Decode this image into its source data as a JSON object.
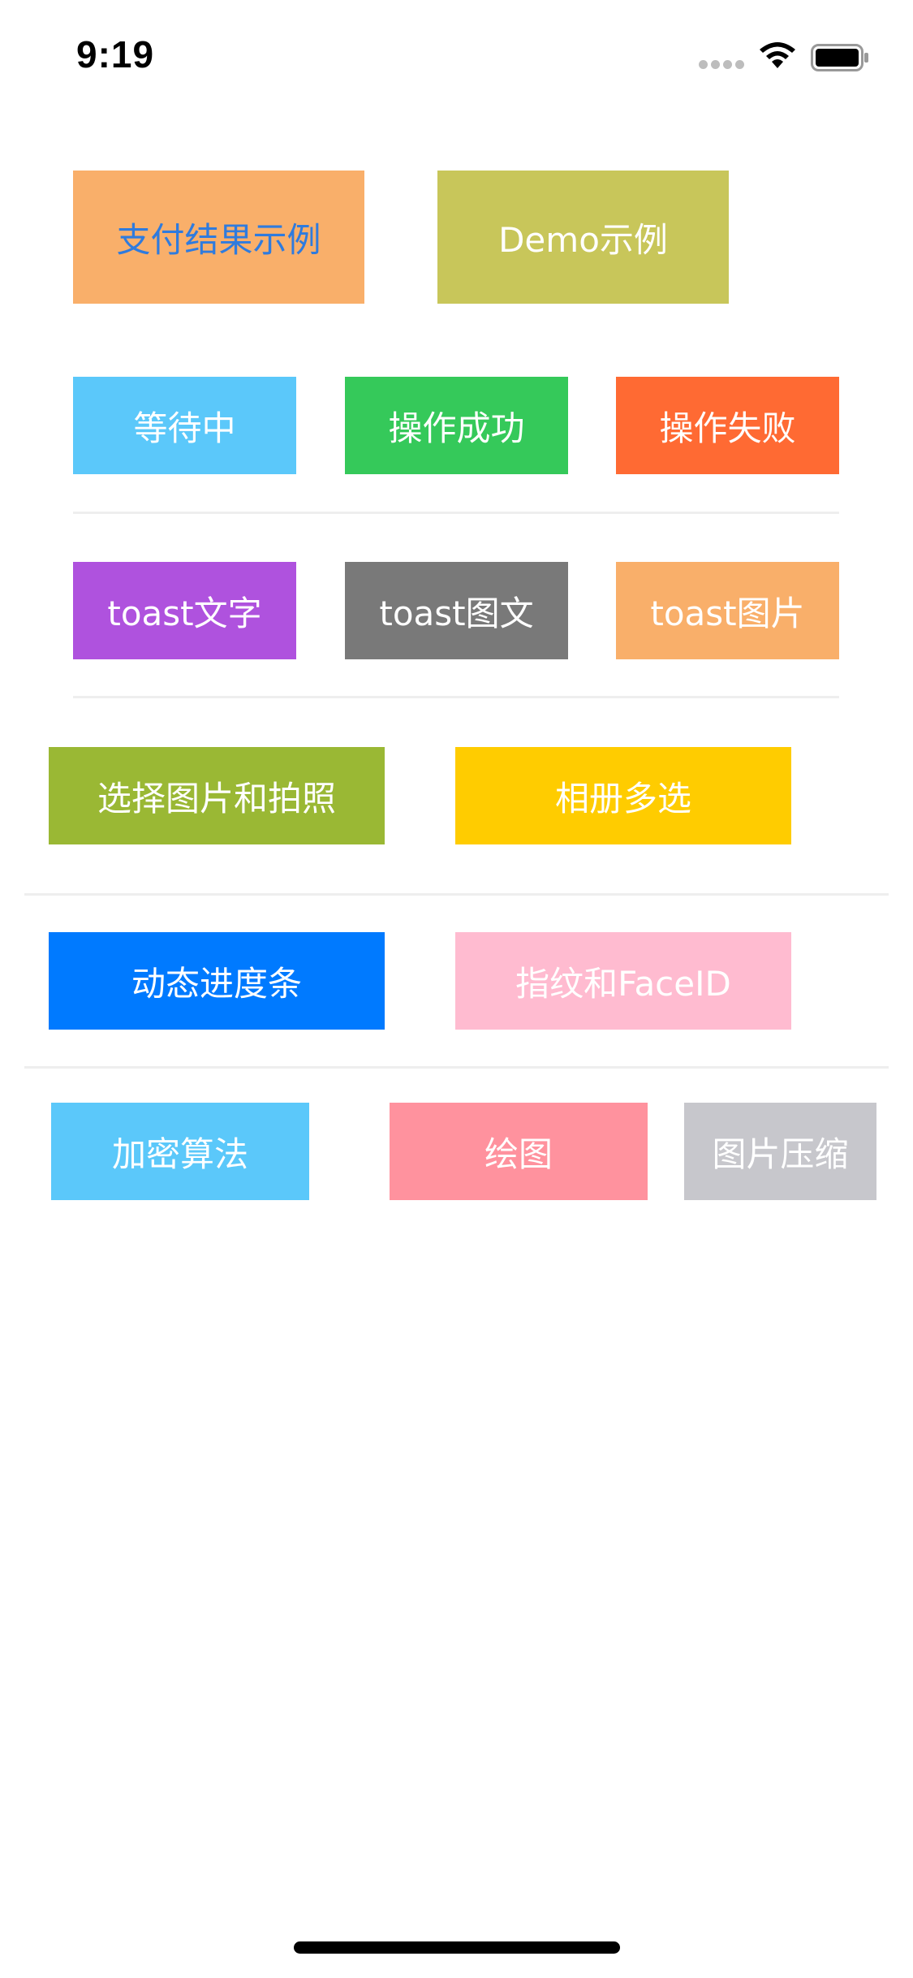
{
  "status_bar": {
    "time": "9:19",
    "signal_icon": "cellular-signal-icon",
    "wifi_icon": "wifi-icon",
    "battery_icon": "battery-icon"
  },
  "buttons": {
    "payment_result": "支付结果示例",
    "demo": "Demo示例",
    "waiting": "等待中",
    "success": "操作成功",
    "failure": "操作失败",
    "toast_text": "toast文字",
    "toast_image_text": "toast图文",
    "toast_image": "toast图片",
    "pick_photo": "选择图片和拍照",
    "album_multi": "相册多选",
    "dynamic_progress": "动态进度条",
    "fingerprint_faceid": "指纹和FaceID",
    "encryption": "加密算法",
    "drawing": "绘图",
    "image_compress": "图片压缩"
  },
  "colors": {
    "orange": "#f9af6a",
    "olive": "#c8c65a",
    "light_blue": "#5bc8fa",
    "green": "#35c95a",
    "red_orange": "#ff6a33",
    "purple": "#af52de",
    "gray": "#797979",
    "lime": "#9ab834",
    "yellow": "#ffcc00",
    "blue": "#007aff",
    "pink": "#ffbbd0",
    "rose": "#ff929e",
    "silver": "#c7c7cc",
    "link_blue": "#2f7bde"
  }
}
